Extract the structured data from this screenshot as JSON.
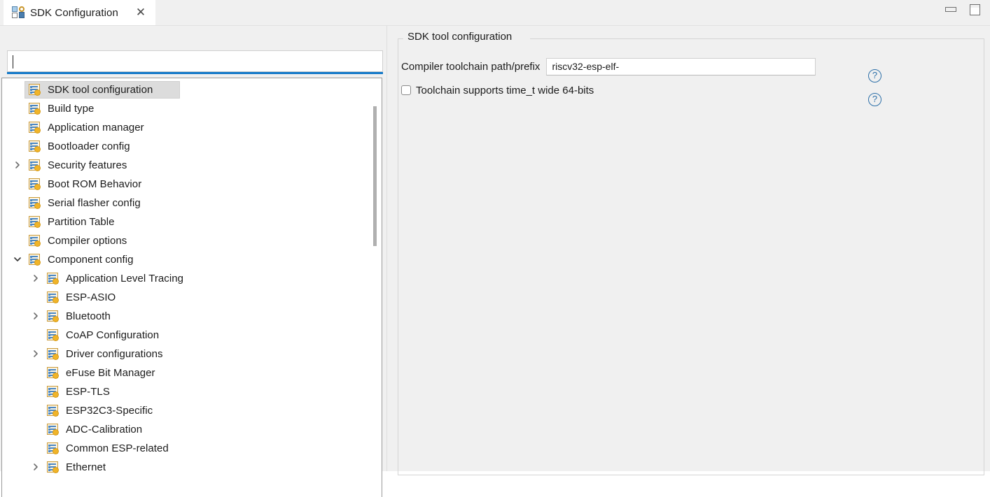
{
  "window": {
    "minimize_label": "Minimize",
    "maximize_label": "Maximize"
  },
  "tab": {
    "title": "SDK Configuration",
    "close_label": "✕",
    "icon": "sdk-config-icon"
  },
  "search": {
    "value": "",
    "placeholder": ""
  },
  "tree": {
    "items": [
      {
        "label": "SDK tool configuration",
        "depth": 0,
        "twisty": "none",
        "selected": true
      },
      {
        "label": "Build type",
        "depth": 0,
        "twisty": "none",
        "selected": false
      },
      {
        "label": "Application manager",
        "depth": 0,
        "twisty": "none",
        "selected": false
      },
      {
        "label": "Bootloader config",
        "depth": 0,
        "twisty": "none",
        "selected": false
      },
      {
        "label": "Security features",
        "depth": 0,
        "twisty": "collapsed",
        "selected": false
      },
      {
        "label": "Boot ROM Behavior",
        "depth": 0,
        "twisty": "none",
        "selected": false
      },
      {
        "label": "Serial flasher config",
        "depth": 0,
        "twisty": "none",
        "selected": false
      },
      {
        "label": "Partition Table",
        "depth": 0,
        "twisty": "none",
        "selected": false
      },
      {
        "label": "Compiler options",
        "depth": 0,
        "twisty": "none",
        "selected": false
      },
      {
        "label": "Component config",
        "depth": 0,
        "twisty": "expanded",
        "selected": false
      },
      {
        "label": "Application Level Tracing",
        "depth": 1,
        "twisty": "collapsed",
        "selected": false
      },
      {
        "label": "ESP-ASIO",
        "depth": 1,
        "twisty": "none",
        "selected": false
      },
      {
        "label": "Bluetooth",
        "depth": 1,
        "twisty": "collapsed",
        "selected": false
      },
      {
        "label": "CoAP Configuration",
        "depth": 1,
        "twisty": "none",
        "selected": false
      },
      {
        "label": "Driver configurations",
        "depth": 1,
        "twisty": "collapsed",
        "selected": false
      },
      {
        "label": "eFuse Bit Manager",
        "depth": 1,
        "twisty": "none",
        "selected": false
      },
      {
        "label": "ESP-TLS",
        "depth": 1,
        "twisty": "none",
        "selected": false
      },
      {
        "label": "ESP32C3-Specific",
        "depth": 1,
        "twisty": "none",
        "selected": false
      },
      {
        "label": "ADC-Calibration",
        "depth": 1,
        "twisty": "none",
        "selected": false
      },
      {
        "label": "Common ESP-related",
        "depth": 1,
        "twisty": "none",
        "selected": false
      },
      {
        "label": "Ethernet",
        "depth": 1,
        "twisty": "collapsed",
        "selected": false
      }
    ]
  },
  "detail": {
    "group_title": "SDK tool configuration",
    "toolchain_label": "Compiler toolchain path/prefix",
    "toolchain_value": "riscv32-esp-elf-",
    "toolchain_placeholder": "",
    "time_t_checkbox_label": "Toolchain supports time_t wide 64-bits",
    "time_t_checked": false,
    "help_glyph": "?"
  },
  "colors": {
    "accent": "#1278c8",
    "selection": "#dcdcdc",
    "panel": "#f0f0f0",
    "help": "#2c6fa8",
    "badge": "#f0b429"
  }
}
